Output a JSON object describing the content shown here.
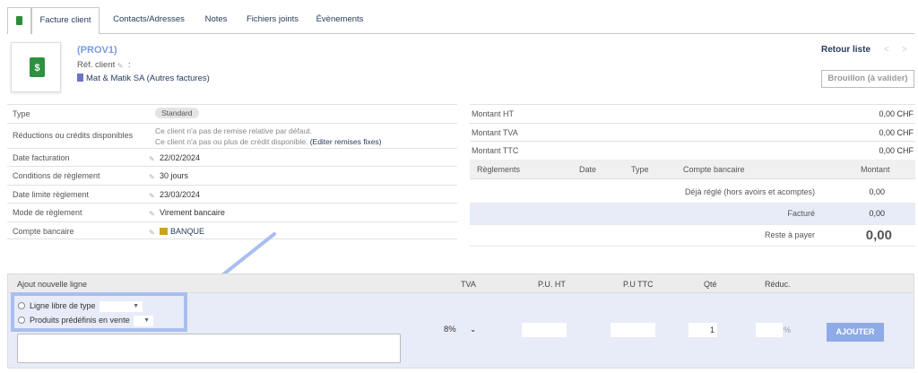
{
  "tabs": [
    "Facture client",
    "Contacts/Adresses",
    "Notes",
    "Fichiers joints",
    "Évènements"
  ],
  "header": {
    "ref": "(PROV1)",
    "ref_client_label": "Réf. client",
    "colon": ":",
    "thirdparty": "Mat & Matik SA (Autres factures)",
    "back_list": "Retour liste",
    "prev": "<",
    "next": ">",
    "status_button": "Brouillon (à valider)",
    "logo_symbol": "$"
  },
  "left_fields": {
    "type_label": "Type",
    "type_value": "Standard",
    "reductions_label": "Réductions ou crédits disponibles",
    "reductions_line1": "Ce client n'a pas de remise relative par défaut.",
    "reductions_line2": "Ce client n'a pas ou plus de crédit disponible.",
    "reductions_link": "(Editer remises fixes)",
    "date_fact_label": "Date facturation",
    "date_fact_value": "22/02/2024",
    "cond_label": "Conditions de règlement",
    "cond_value": "30 jours",
    "date_limit_label": "Date limite règlement",
    "date_limit_value": "23/03/2024",
    "mode_label": "Mode de règlement",
    "mode_value": "Virement bancaire",
    "compte_label": "Compte bancaire",
    "compte_value": "BANQUE"
  },
  "amounts": {
    "ht_label": "Montant HT",
    "ht_value": "0,00 CHF",
    "tva_label": "Montant TVA",
    "tva_value": "0,00 CHF",
    "ttc_label": "Montant TTC",
    "ttc_value": "0,00 CHF"
  },
  "payments": {
    "headers": {
      "reglements": "Règlements",
      "date": "Date",
      "type": "Type",
      "compte": "Compte bancaire",
      "montant": "Montant"
    },
    "deja_label": "Déjà réglé (hors avoirs et acomptes)",
    "deja_value": "0,00",
    "facture_label": "Facturé",
    "facture_value": "0,00",
    "reste_label": "Reste à payer",
    "reste_value": "0,00"
  },
  "add_line": {
    "title": "Ajout nouvelle ligne",
    "col_tva": "TVA",
    "col_pu_ht": "P.U. HT",
    "col_pu_ttc": "P.U TTC",
    "col_qte": "Qté",
    "col_reduc": "Réduc.",
    "opt_libre": "Ligne libre de type",
    "opt_predef": "Produits prédéfinis en vente",
    "tva_value": "8%",
    "qty_value": "1",
    "percent": "%",
    "add_button": "AJOUTER"
  },
  "colors": {
    "accent": "#263c5c",
    "green": "#1e8e2e",
    "highlight": "#a9bef0",
    "ref": "#7a9ae4"
  }
}
